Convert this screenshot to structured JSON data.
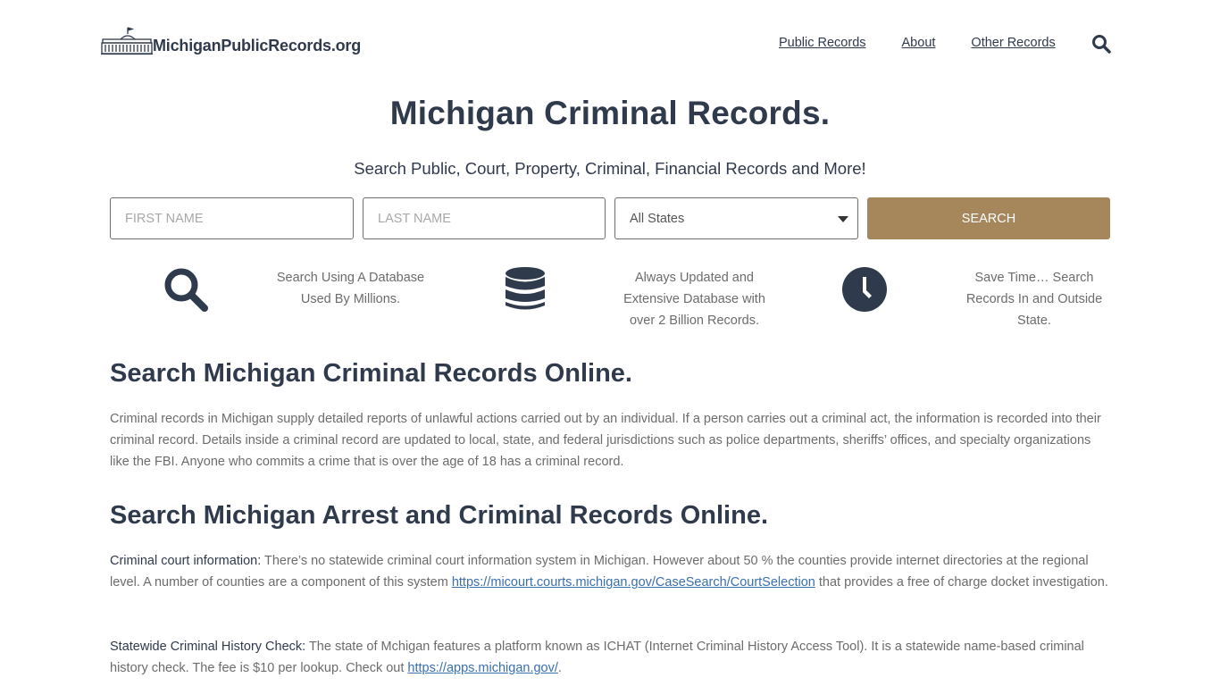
{
  "header": {
    "logo_text": "MichiganPublicRecords.org",
    "nav": [
      {
        "label": "Public Records"
      },
      {
        "label": "About"
      },
      {
        "label": "Other Records"
      }
    ]
  },
  "hero": {
    "title": "Michigan Criminal Records.",
    "subtitle": "Search Public, Court, Property, Criminal, Financial Records and More!"
  },
  "search_form": {
    "first_name_placeholder": "FIRST NAME",
    "last_name_placeholder": "LAST NAME",
    "state_selected": "All States",
    "button_label": "SEARCH"
  },
  "features": [
    {
      "icon": "search-icon",
      "text_lines": [
        "Search Using A Database",
        "Used By Millions."
      ]
    },
    {
      "icon": "database-icon",
      "text_lines": [
        "Always Updated and",
        "Extensive Database with",
        "over 2 Billion Records."
      ]
    },
    {
      "icon": "clock-icon",
      "text_lines": [
        "Save Time… Search",
        "Records In and Outside",
        "State."
      ]
    }
  ],
  "sections": [
    {
      "heading": "Search Michigan Criminal Records Online.",
      "paragraph": "Criminal records in Michigan supply detailed reports of unlawful actions carried out by an individual. If a person carries out a criminal act, the information is recorded into their criminal record. Details inside a criminal record are updated to local, state, and federal jurisdictions such as police departments, sheriffs’ offices, and specialty organizations like the FBI. Anyone who commits a crime that is over the age of 18 has a criminal record."
    },
    {
      "heading": "Search Michigan Arrest and Criminal Records Online.",
      "items": [
        {
          "label": "Criminal court information:",
          "text_before": " There’s no statewide criminal court information system in Michigan. However about 50 % the counties provide internet directories at the regional level. A number of counties are a component of this system ",
          "link": "https://micourt.courts.michigan.gov/CaseSearch/CourtSelection",
          "text_after": " that provides a free of charge docket investigation."
        },
        {
          "label": "Statewide Criminal History Check:",
          "text_before": " The state of Mchigan features a platform known as ICHAT (Internet Criminal History Access Tool). It is a statewide name-based criminal history check. The fee is $10 per lookup. Check out ",
          "link": "https://apps.michigan.gov/",
          "text_after": "."
        }
      ]
    }
  ],
  "colors": {
    "text_dark": "#2f3a4c",
    "text_body": "#6c6c6c",
    "button_bg": "#a6875c",
    "link": "#3a6fb0"
  }
}
